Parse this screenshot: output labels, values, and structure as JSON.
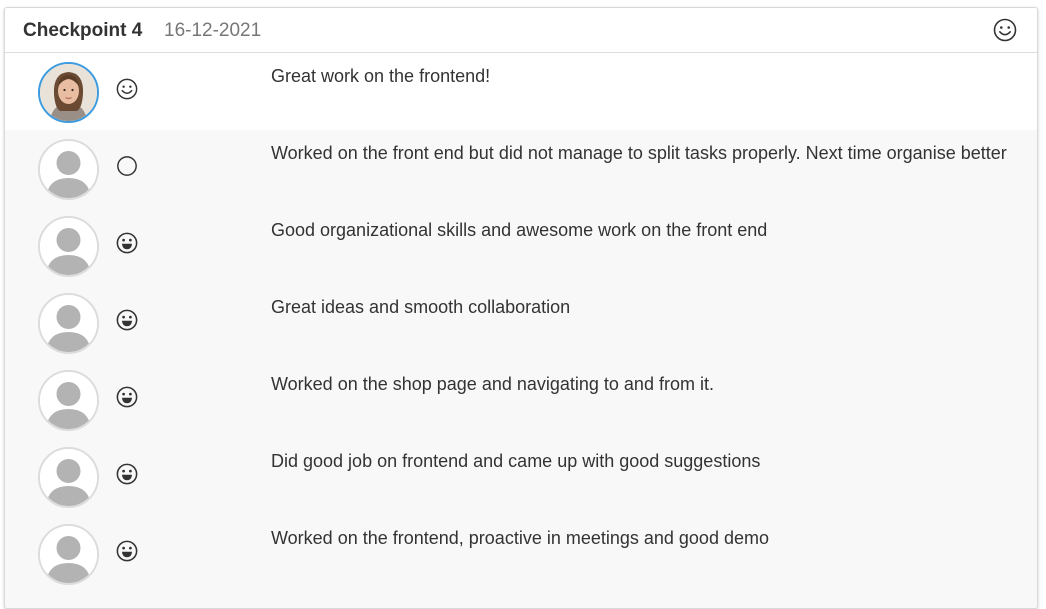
{
  "header": {
    "title": "Checkpoint 4",
    "date": "16-12-2021",
    "mood_icon": "smile-icon"
  },
  "feedback": [
    {
      "avatar": "user-photo-avatar",
      "mood_icon": "smile-icon",
      "comment": "Great work on the frontend!"
    },
    {
      "avatar": "placeholder-avatar",
      "mood_icon": "neutral-circle-icon",
      "comment": "Worked on the front end but did not manage to split tasks properly. Next time organise better"
    },
    {
      "avatar": "placeholder-avatar",
      "mood_icon": "grin-icon",
      "comment": "Good organizational skills and awesome work on the front end"
    },
    {
      "avatar": "placeholder-avatar",
      "mood_icon": "grin-icon",
      "comment": "Great ideas and smooth collaboration"
    },
    {
      "avatar": "placeholder-avatar",
      "mood_icon": "grin-icon",
      "comment": "Worked on the shop page and navigating to and from it."
    },
    {
      "avatar": "placeholder-avatar",
      "mood_icon": "grin-icon",
      "comment": "Did good job on frontend and came up with good suggestions"
    },
    {
      "avatar": "placeholder-avatar",
      "mood_icon": "grin-icon",
      "comment": "Worked on the frontend, proactive in meetings and good demo"
    }
  ],
  "colors": {
    "avatar_highlight": "#3d9be0",
    "text": "#333333",
    "date": "#777777",
    "row_background": "#f8f8f8"
  }
}
